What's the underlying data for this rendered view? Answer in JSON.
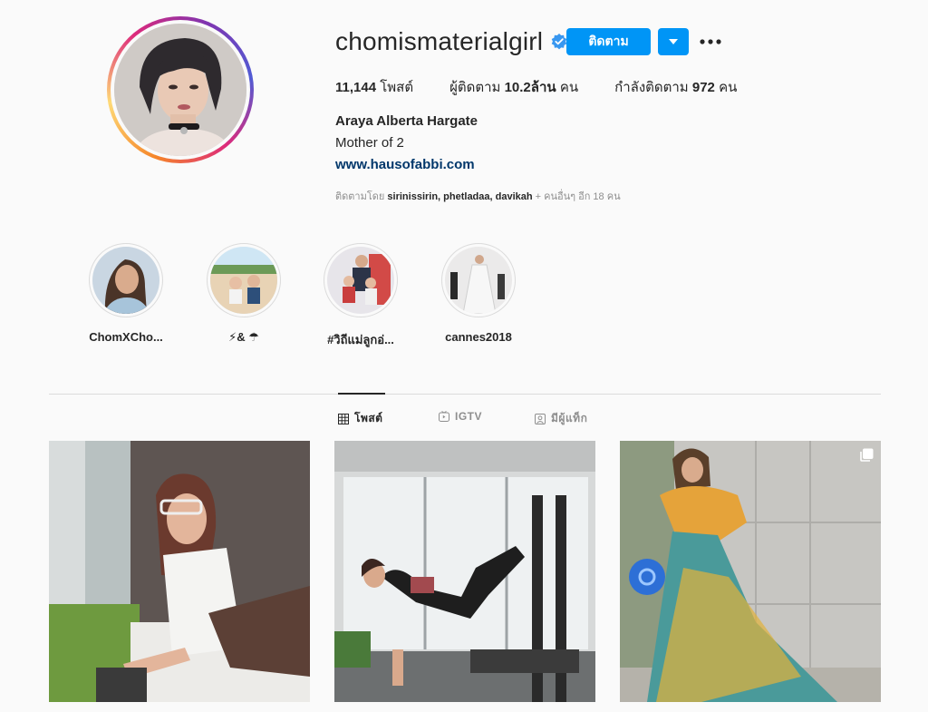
{
  "profile": {
    "username": "chomismaterialgirl",
    "verified": true,
    "follow_label": "ติดตาม",
    "stats": {
      "posts_value": "11,144",
      "posts_label": "โพสต์",
      "followers_label": "ผู้ติดตาม",
      "followers_value": "10.2ล้าน",
      "followers_unit": "คน",
      "following_label": "กำลังติดตาม",
      "following_value": "972",
      "following_unit": "คน"
    },
    "full_name": "Araya Alberta Hargate",
    "bio": "Mother of 2",
    "website": "www.hausofabbi.com",
    "followed_by_prefix": "ติดตามโดย",
    "followed_by_names": "sirinissirin, phetladaa, davikah",
    "followed_by_suffix": "+ คนอื่นๆ อีก 18 คน"
  },
  "highlights": [
    {
      "label": "ChomXCho..."
    },
    {
      "label": "⚡& ☂"
    },
    {
      "label": "#วิถีแม่ลูกอ่..."
    },
    {
      "label": "cannes2018"
    }
  ],
  "tabs": {
    "posts": "โพสต์",
    "igtv": "IGTV",
    "tagged": "มีผู้แท็ก"
  },
  "colors": {
    "accent": "#0095f6",
    "text": "#262626",
    "muted": "#8e8e8e",
    "link": "#00376b",
    "background": "#fafafa"
  },
  "icons": {
    "verified": "verified-badge-icon",
    "dropdown": "chevron-down-icon",
    "more": "more-options-icon",
    "posts_tab": "grid-icon",
    "igtv_tab": "igtv-icon",
    "tagged_tab": "tagged-user-icon",
    "carousel": "multiple-photos-icon"
  }
}
